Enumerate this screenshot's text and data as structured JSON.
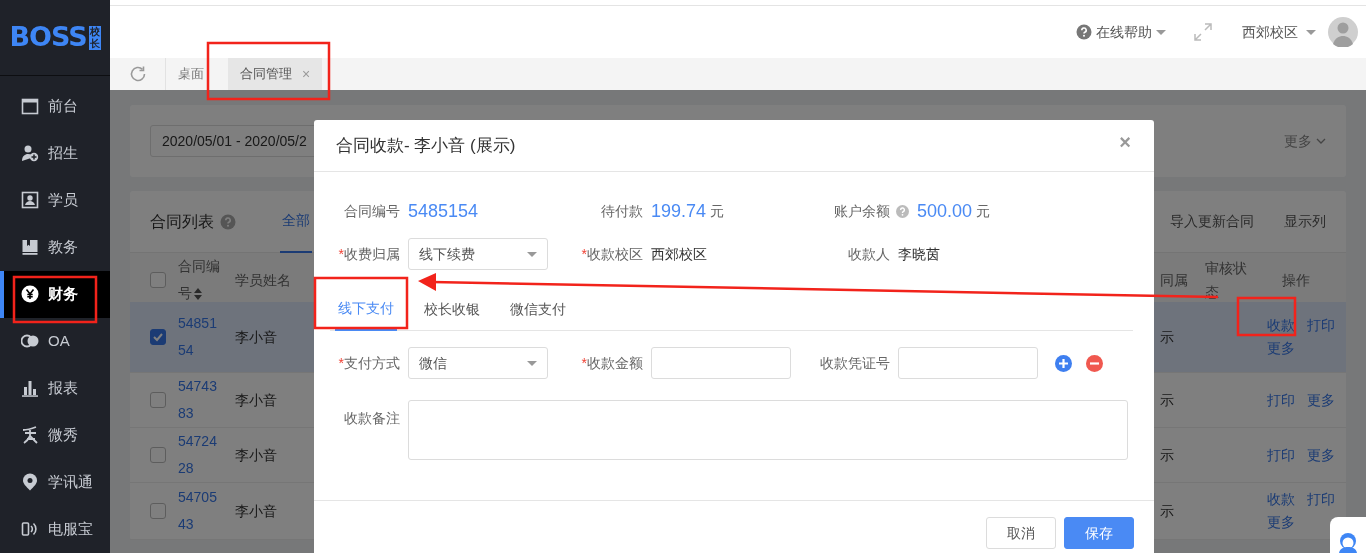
{
  "sidebar": {
    "logo": "BOSS",
    "logo_badge": [
      "校",
      "长"
    ],
    "items": [
      {
        "label": "前台",
        "selected": false
      },
      {
        "label": "招生",
        "selected": false
      },
      {
        "label": "学员",
        "selected": false
      },
      {
        "label": "教务",
        "selected": false
      },
      {
        "label": "财务",
        "selected": true
      },
      {
        "label": "OA",
        "selected": false
      },
      {
        "label": "报表",
        "selected": false
      },
      {
        "label": "微秀",
        "selected": false
      },
      {
        "label": "学讯通",
        "selected": false
      },
      {
        "label": "电服宝",
        "selected": false
      }
    ]
  },
  "header": {
    "help": "在线帮助",
    "campus": "西郊校区"
  },
  "page_tabs": [
    {
      "label": "桌面",
      "selected": false
    },
    {
      "label": "合同管理",
      "selected": true,
      "close": "×"
    }
  ],
  "filter": {
    "date_range": "2020/05/01 - 2020/05/2",
    "more": "更多"
  },
  "contract_list": {
    "title": "合同列表",
    "tab": "全部",
    "all_checked": false,
    "actions": [
      "导入更新合同",
      "显示列"
    ],
    "columns": [
      "合同编号",
      "学员姓名",
      "同属",
      "审核状态",
      "操作"
    ],
    "rows": [
      {
        "checked": true,
        "selected": true,
        "contract_no": "5485154",
        "student": "李小音",
        "column_3": "示",
        "actions": [
          "收款",
          "打印",
          "更多"
        ]
      },
      {
        "checked": false,
        "selected": false,
        "contract_no": "5474383",
        "student": "李小音",
        "column_3": "示",
        "actions": [
          "打印",
          "更多"
        ]
      },
      {
        "checked": false,
        "selected": false,
        "contract_no": "5472428",
        "student": "李小音",
        "column_3": "示",
        "actions": [
          "打印",
          "更多"
        ]
      },
      {
        "checked": false,
        "selected": false,
        "contract_no": "5470543",
        "student": "李小音",
        "column_3": "示",
        "actions": [
          "收款",
          "打印",
          "更多"
        ]
      }
    ]
  },
  "dialog": {
    "title": "合同收款- 李小音 (展示)",
    "close": "×",
    "info": [
      {
        "label": "合同编号",
        "value": "5485154"
      },
      {
        "label": "待付款",
        "value": "199.74",
        "unit": "元"
      },
      {
        "label": "账户余额",
        "value": "500.00",
        "unit": "元",
        "help": true
      }
    ],
    "fields": [
      {
        "kind": "select",
        "mark": "*",
        "label": "收费归属",
        "value": "线下续费"
      },
      {
        "kind": "text",
        "mark": "*",
        "label": "收款校区",
        "value": "西郊校区"
      },
      {
        "kind": "text",
        "label": "收款人",
        "value": "李晓茵"
      }
    ],
    "tabs": [
      {
        "label": "线下支付",
        "selected": true
      },
      {
        "label": "校长收银",
        "selected": false
      },
      {
        "label": "微信支付",
        "selected": false
      }
    ],
    "payment": [
      {
        "kind": "select",
        "mark": "*",
        "label": "支付方式",
        "value": "微信"
      },
      {
        "kind": "input",
        "mark": "*",
        "label": "收款金额"
      },
      {
        "kind": "input",
        "label": "收款凭证号"
      }
    ],
    "remark": {
      "label": "收款备注"
    },
    "buttons": [
      {
        "label": "取消",
        "kind": "secondary"
      },
      {
        "label": "保存",
        "kind": "primary"
      }
    ]
  }
}
